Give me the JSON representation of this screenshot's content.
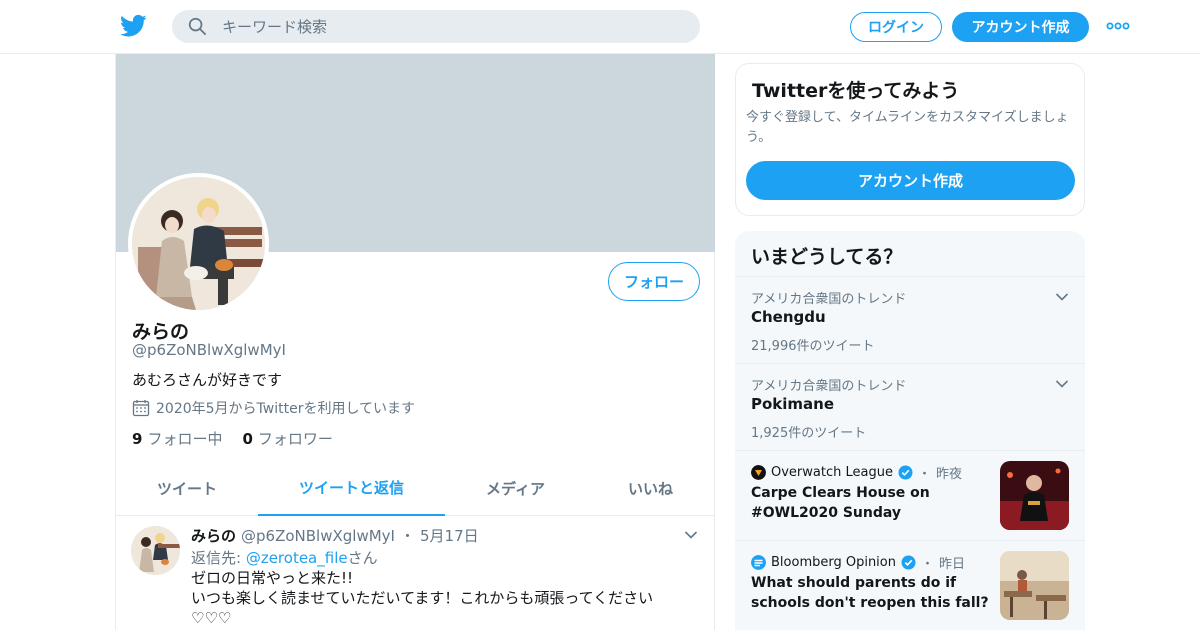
{
  "header": {
    "search_placeholder": "キーワード検索",
    "login_label": "ログイン",
    "signup_label": "アカウント作成",
    "brand_color": "#1da1f2"
  },
  "profile": {
    "display_name": "みらの",
    "handle": "@p6ZoNBlwXglwMyI",
    "bio": "あむろさんが好きです",
    "joined": "2020年5月からTwitterを利用しています",
    "follow_label": "フォロー",
    "following_count": "9",
    "following_label": "フォロー中",
    "followers_count": "0",
    "followers_label": "フォロワー",
    "banner_color": "#ccd6dd"
  },
  "tabs": [
    {
      "label": "ツイート",
      "active": false
    },
    {
      "label": "ツイートと返信",
      "active": true
    },
    {
      "label": "メディア",
      "active": false
    },
    {
      "label": "いいね",
      "active": false
    }
  ],
  "tweet": {
    "name": "みらの",
    "handle": "@p6ZoNBlwXglwMyI",
    "dot": "・",
    "date": "5月17日",
    "reply_prefix": "返信先: ",
    "reply_link": "@zerotea_file",
    "reply_suffix": "さん",
    "line1": "ゼロの日常やっと来た!!",
    "line2": "いつも楽しく読ませていただいてます！これからも頑張ってください",
    "line3": "♡♡♡"
  },
  "signup_card": {
    "title": "Twitterを使ってみよう",
    "subtitle": "今すぐ登録して、タイムラインをカスタマイズしましょう。",
    "button": "アカウント作成"
  },
  "trends": {
    "title": "いまどうしてる？",
    "items": [
      {
        "meta": "アメリカ合衆国のトレンド",
        "name": "Chengdu",
        "count": "21,996件のツイート"
      },
      {
        "meta": "アメリカ合衆国のトレンド",
        "name": "Pokimane",
        "count": "1,925件のツイート"
      }
    ],
    "news": [
      {
        "source": "Overwatch League",
        "dot": "・",
        "time": "昨夜",
        "headline": "Carpe Clears House on #OWL2020 Sunday",
        "logo_color": "#111111",
        "logo_icon": "overwatch-league-logo-icon"
      },
      {
        "source": "Bloomberg Opinion",
        "dot": "・",
        "time": "昨日",
        "headline": "What should parents do if schools don't reopen this fall?",
        "logo_color": "#1da1f2",
        "logo_icon": "bloomberg-opinion-logo-icon"
      }
    ]
  }
}
